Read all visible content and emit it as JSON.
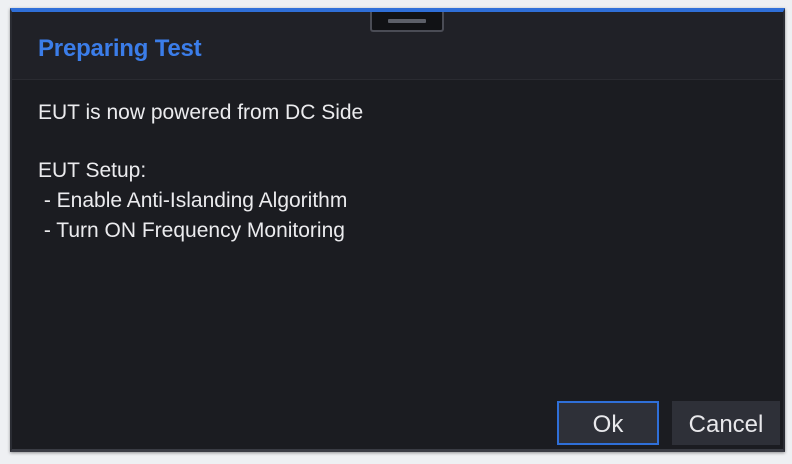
{
  "dialog": {
    "title": "Preparing Test",
    "message_line_1": "EUT is now powered from DC Side",
    "setup_heading": "EUT Setup:",
    "setup_items": [
      " - Enable Anti-Islanding Algorithm",
      " - Turn ON Frequency Monitoring"
    ],
    "ok_label": "Ok",
    "cancel_label": "Cancel",
    "colors": {
      "accent": "#2f6fd8",
      "title": "#3b7de9",
      "background": "#1b1c21",
      "button": "#2e3038",
      "text": "#ebebee"
    }
  }
}
